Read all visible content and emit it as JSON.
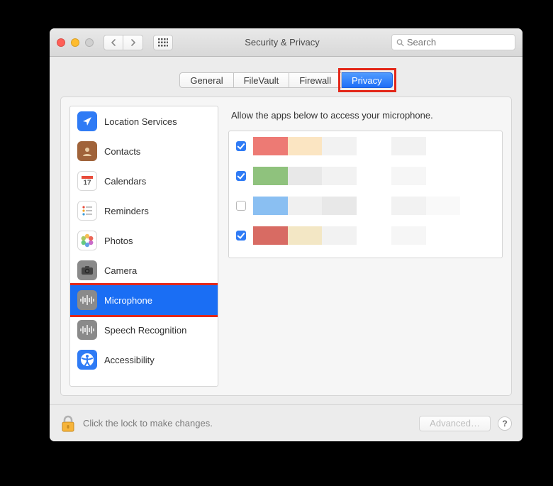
{
  "window": {
    "title": "Security & Privacy",
    "search_placeholder": "Search"
  },
  "tabs": [
    {
      "id": "general",
      "label": "General",
      "active": false
    },
    {
      "id": "filevault",
      "label": "FileVault",
      "active": false
    },
    {
      "id": "firewall",
      "label": "Firewall",
      "active": false
    },
    {
      "id": "privacy",
      "label": "Privacy",
      "active": true
    }
  ],
  "highlighted_tab": "privacy",
  "categories": [
    {
      "id": "location",
      "label": "Location Services",
      "icon": "location-icon",
      "icon_bg": "#2f7bf5",
      "selected": false
    },
    {
      "id": "contacts",
      "label": "Contacts",
      "icon": "contacts-icon",
      "icon_bg": "#a0633a",
      "selected": false
    },
    {
      "id": "calendars",
      "label": "Calendars",
      "icon": "calendar-icon",
      "icon_bg": "#ffffff",
      "selected": false
    },
    {
      "id": "reminders",
      "label": "Reminders",
      "icon": "reminders-icon",
      "icon_bg": "#ffffff",
      "selected": false
    },
    {
      "id": "photos",
      "label": "Photos",
      "icon": "photos-icon",
      "icon_bg": "#ffffff",
      "selected": false
    },
    {
      "id": "camera",
      "label": "Camera",
      "icon": "camera-icon",
      "icon_bg": "#8a8a8a",
      "selected": false
    },
    {
      "id": "microphone",
      "label": "Microphone",
      "icon": "microphone-icon",
      "icon_bg": "#8a8a8a",
      "selected": true
    },
    {
      "id": "speech",
      "label": "Speech Recognition",
      "icon": "speech-icon",
      "icon_bg": "#8a8a8a",
      "selected": false
    },
    {
      "id": "accessibility",
      "label": "Accessibility",
      "icon": "accessibility-icon",
      "icon_bg": "#2f7bf5",
      "selected": false
    }
  ],
  "highlighted_category": "microphone",
  "content": {
    "description": "Allow the apps below to access your microphone.",
    "apps": [
      {
        "checked": true,
        "censored": true,
        "colors": [
          "#ed7a74",
          "#fbe5c2",
          "#f2f2f2",
          "#ffffff",
          "#f2f2f2",
          "#ffffff",
          "#ffffff"
        ]
      },
      {
        "checked": true,
        "censored": true,
        "colors": [
          "#8fc27d",
          "#e8e8e8",
          "#f2f2f2",
          "#ffffff",
          "#f6f6f6",
          "#ffffff",
          "#ffffff"
        ]
      },
      {
        "checked": false,
        "censored": true,
        "colors": [
          "#8abff2",
          "#f0f0f0",
          "#e8e8e8",
          "#ffffff",
          "#f2f2f2",
          "#f9f9f9",
          "#ffffff"
        ]
      },
      {
        "checked": true,
        "censored": true,
        "colors": [
          "#d86b63",
          "#f3e7c5",
          "#f2f2f2",
          "#ffffff",
          "#f6f6f6",
          "#ffffff",
          "#ffffff"
        ]
      }
    ]
  },
  "footer": {
    "lock_text": "Click the lock to make changes.",
    "advanced_label": "Advanced…",
    "help_label": "?"
  }
}
